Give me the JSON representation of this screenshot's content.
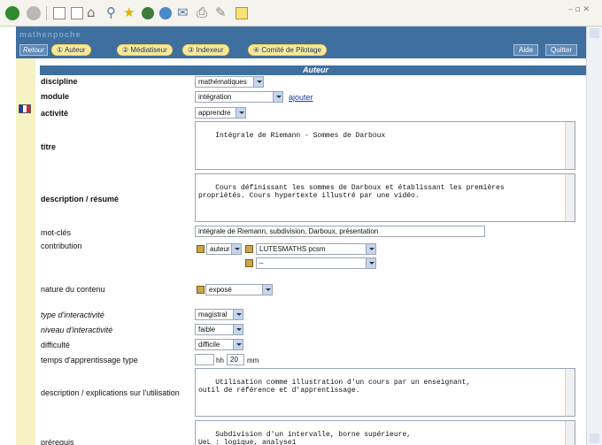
{
  "header": {
    "logo": "mathenpoche",
    "nav": {
      "retour": "Retour",
      "tab1": "① Auteur",
      "tab2": "② Médiatiseur",
      "tab3": "③ Indexeur",
      "tab4": "④ Comité de Pilotage",
      "aide": "Aide",
      "quitter": "Quitter"
    }
  },
  "section_title": "Auteur",
  "flag_colors": [
    "#1f3d9b",
    "#ffffff",
    "#d8262d"
  ],
  "fields": {
    "discipline": {
      "label": "discipline",
      "value": "mathématiques"
    },
    "module": {
      "label": "module",
      "value": "intégration",
      "link": "ajouter"
    },
    "activite": {
      "label": "activité",
      "value": "apprendre"
    },
    "titre": {
      "label": "titre",
      "value": "Intégrale de Riemann - Sommes de Darboux"
    },
    "description": {
      "label": "description / résumé",
      "value": "Cours définissant les sommes de Darboux et établissant les premières\npropriétés. Cours hypertexte illustré par une vidéo."
    },
    "mot_cles": {
      "label": "mot-clés",
      "value": "intégrale de Riemann, subdivision, Darboux, présentation"
    },
    "contribution": {
      "label": "contribution",
      "role": "auteur",
      "name": "LUTESMATHS pcsm",
      "empty": "–"
    },
    "nature": {
      "label": "nature du contenu",
      "value": "exposé"
    },
    "type_inter": {
      "label": "type d'interactivité",
      "value": "magistral"
    },
    "niveau_inter": {
      "label": "niveau d'interactivité",
      "value": "faible"
    },
    "difficulte": {
      "label": "difficulté",
      "value": "difficile"
    },
    "temps": {
      "label": "temps d'apprentissage type",
      "hh": "",
      "hh_unit": "hh",
      "mm": "20",
      "mm_unit": "mm"
    },
    "explications": {
      "label": "description / explications sur l'utilisation",
      "value": "Utilisation comme illustration d'un cours par un enseignant,\noutil de référence et d'apprentissage."
    },
    "prerequis": {
      "label": "prérequis",
      "value": "Subdivision d'un intervalle, borne supérieure,\nUeL : logique, analyse1"
    }
  }
}
